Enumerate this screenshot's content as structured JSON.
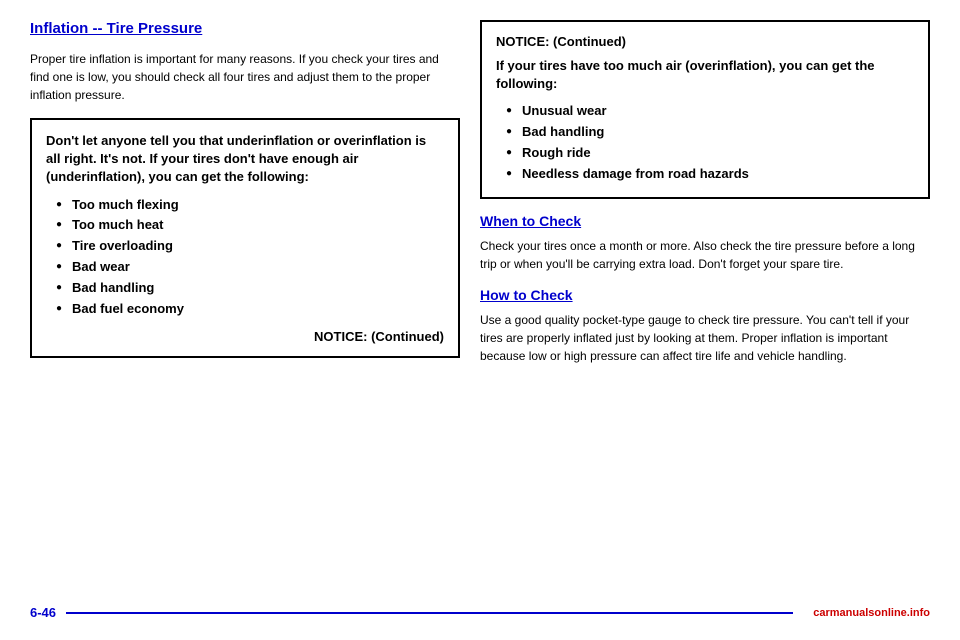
{
  "page": {
    "title": "Inflation -- Tire Pressure",
    "footer_page_num": "6-46",
    "footer_logo": "carmanualsonline.info"
  },
  "left_column": {
    "body_text_1": "Proper tire inflation is important for many reasons. If you check your tires and find one is low, you should check all four tires and adjust them to the proper inflation pressure.",
    "notice_box": {
      "title": "Don't let anyone tell you that underinflation or overinflation is all right. It's not. If your tires don't have enough air (underinflation), you can get the following:",
      "bullets": [
        "Too much flexing",
        "Too much heat",
        "Tire overloading",
        "Bad wear",
        "Bad handling",
        "Bad fuel economy"
      ],
      "continued_label": "NOTICE: (Continued)"
    }
  },
  "right_column": {
    "notice_continued_box": {
      "title": "NOTICE: (Continued)",
      "intro_text": "If your tires have too much air (overinflation), you can get the following:",
      "bullets": [
        "Unusual wear",
        "Bad handling",
        "Rough ride",
        "Needless damage from road hazards"
      ]
    },
    "when_to_check": {
      "heading": "When to Check",
      "body_text": "Check your tires once a month or more. Also check the tire pressure before a long trip or when you'll be carrying extra load. Don't forget your spare tire."
    },
    "how_to_check": {
      "heading": "How to Check",
      "body_text": "Use a good quality pocket-type gauge to check tire pressure. You can't tell if your tires are properly inflated just by looking at them. Proper inflation is important because low or high pressure can affect tire life and vehicle handling."
    }
  }
}
